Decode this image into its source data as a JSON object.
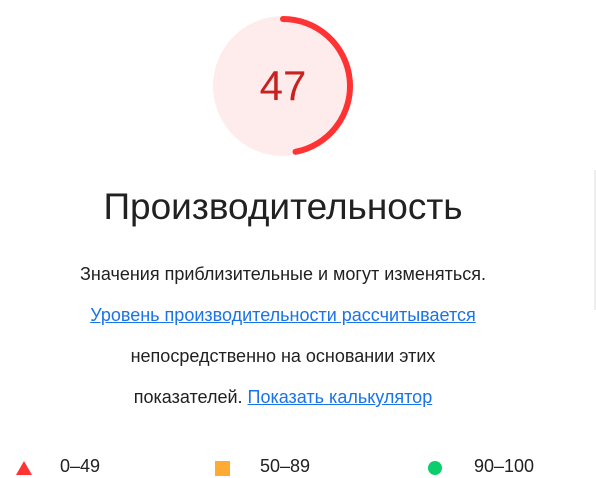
{
  "score": {
    "value": "47",
    "fraction": 0.47,
    "color": "#c7221f",
    "arc_color": "#ff3333",
    "fill_color": "#fdeceb"
  },
  "title": "Производительность",
  "description": {
    "line1": "Значения приблизительные и могут изменяться.",
    "link1": "Уровень производительности рассчитывается",
    "line3": "непосредственно на основании этих",
    "line4_prefix": "показателей.",
    "link2": "Показать калькулятор"
  },
  "legend": [
    {
      "range": "0–49",
      "shape": "triangle-icon",
      "color": "#ff3333"
    },
    {
      "range": "50–89",
      "shape": "square-icon",
      "color": "#ffaa33"
    },
    {
      "range": "90–100",
      "shape": "circle-icon",
      "color": "#0cce6b"
    }
  ],
  "link_color": "#1a73e8"
}
